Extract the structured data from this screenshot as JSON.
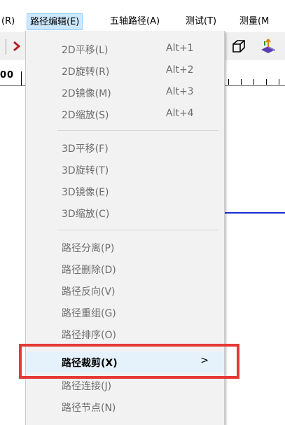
{
  "menubar": {
    "items": [
      "(R)",
      "路径编辑(E)",
      "五轴路径(A)",
      "测试(T)",
      "测量(M"
    ]
  },
  "ruler": {
    "label": "00"
  },
  "menu": {
    "transform2d": [
      {
        "label": "2D平移(L)",
        "shortcut": "Alt+1"
      },
      {
        "label": "2D旋转(R)",
        "shortcut": "Alt+2"
      },
      {
        "label": "2D镜像(M)",
        "shortcut": "Alt+3"
      },
      {
        "label": "2D缩放(S)",
        "shortcut": "Alt+4"
      }
    ],
    "transform3d": [
      {
        "label": "3D平移(F)"
      },
      {
        "label": "3D旋转(T)"
      },
      {
        "label": "3D镜像(E)"
      },
      {
        "label": "3D缩放(C)"
      }
    ],
    "path_ops": [
      {
        "label": "路径分离(P)"
      },
      {
        "label": "路径删除(D)"
      },
      {
        "label": "路径反向(V)"
      },
      {
        "label": "路径重组(G)"
      },
      {
        "label": "路径排序(O)"
      },
      {
        "label": "路径裁剪(X)",
        "submenu_arrow": ">"
      },
      {
        "label": "路径连接(J)"
      },
      {
        "label": "路径节点(N)"
      }
    ]
  },
  "colors": {
    "menu_bg": "#f2f2f2",
    "hover_bg": "#e5f1fb",
    "annotation_red": "#e53935",
    "canvas_line": "#1a2bd6"
  }
}
